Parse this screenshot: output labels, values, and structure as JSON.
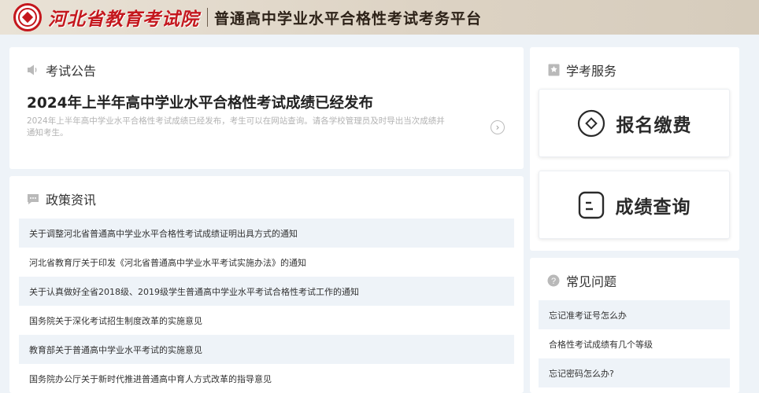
{
  "header": {
    "org_name": "河北省教育考试院",
    "platform_name": "普通高中学业水平合格性考试考务平台"
  },
  "announcement": {
    "section_title": "考试公告",
    "headline": "2024年上半年高中学业水平合格性考试成绩已经发布",
    "summary": "2024年上半年高中学业水平合格性考试成绩已经发布，考生可以在网站查询。请各学校管理员及时导出当次成绩并通知考生。",
    "more_icon": "chevron-right-circle-icon"
  },
  "policy": {
    "section_title": "政策资讯",
    "items": [
      "关于调整河北省普通高中学业水平合格性考试成绩证明出具方式的通知",
      "河北省教育厅关于印发《河北省普通高中学业水平考试实施办法》的通知",
      "关于认真做好全省2018级、2019级学生普通高中学业水平考试合格性考试工作的通知",
      "国务院关于深化考试招生制度改革的实施意见",
      "教育部关于普通高中学业水平考试的实施意见",
      "国务院办公厅关于新时代推进普通高中育人方式改革的指导意见"
    ]
  },
  "service": {
    "section_title": "学考服务",
    "buttons": [
      {
        "label": "报名缴费",
        "icon": "register-pay-icon"
      },
      {
        "label": "成绩查询",
        "icon": "score-query-icon"
      }
    ]
  },
  "faq": {
    "section_title": "常见问题",
    "items": [
      "忘记准考证号怎么办",
      "合格性考试成绩有几个等级",
      "忘记密码怎么办?"
    ]
  },
  "colors": {
    "brand_red": "#c4171d",
    "page_bg": "#eef3f8",
    "muted_text": "#b3b3b3"
  }
}
